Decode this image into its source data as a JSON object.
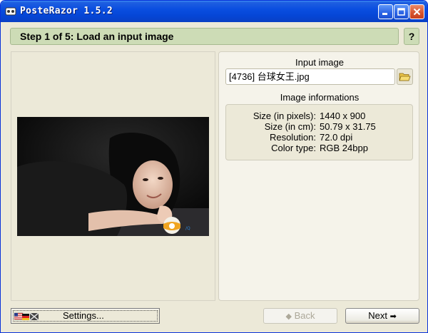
{
  "window": {
    "title": "PosteRazor 1.5.2",
    "icon": "posterazor-app-icon"
  },
  "header": {
    "step_title": "Step 1 of 5: Load an input image",
    "help_label": "?"
  },
  "input": {
    "section_label": "Input image",
    "file_value": "[4736] 台球女王.jpg",
    "folder_icon": "folder-open-icon"
  },
  "image_info": {
    "section_label": "Image informations",
    "rows": [
      {
        "key": "Size (in pixels):",
        "value": "1440 x 900"
      },
      {
        "key": "Size (in cm):",
        "value": "50.79 x 31.75"
      },
      {
        "key": "Resolution:",
        "value": "72.0 dpi"
      },
      {
        "key": "Color type:",
        "value": "RGB 24bpp"
      }
    ]
  },
  "footer": {
    "settings_label": "Settings...",
    "back_label": "Back",
    "next_label": "Next"
  },
  "colors": {
    "titlebar": "#0a4ee0",
    "stepbar": "#cddcb6",
    "window_bg": "#ece9d8"
  }
}
